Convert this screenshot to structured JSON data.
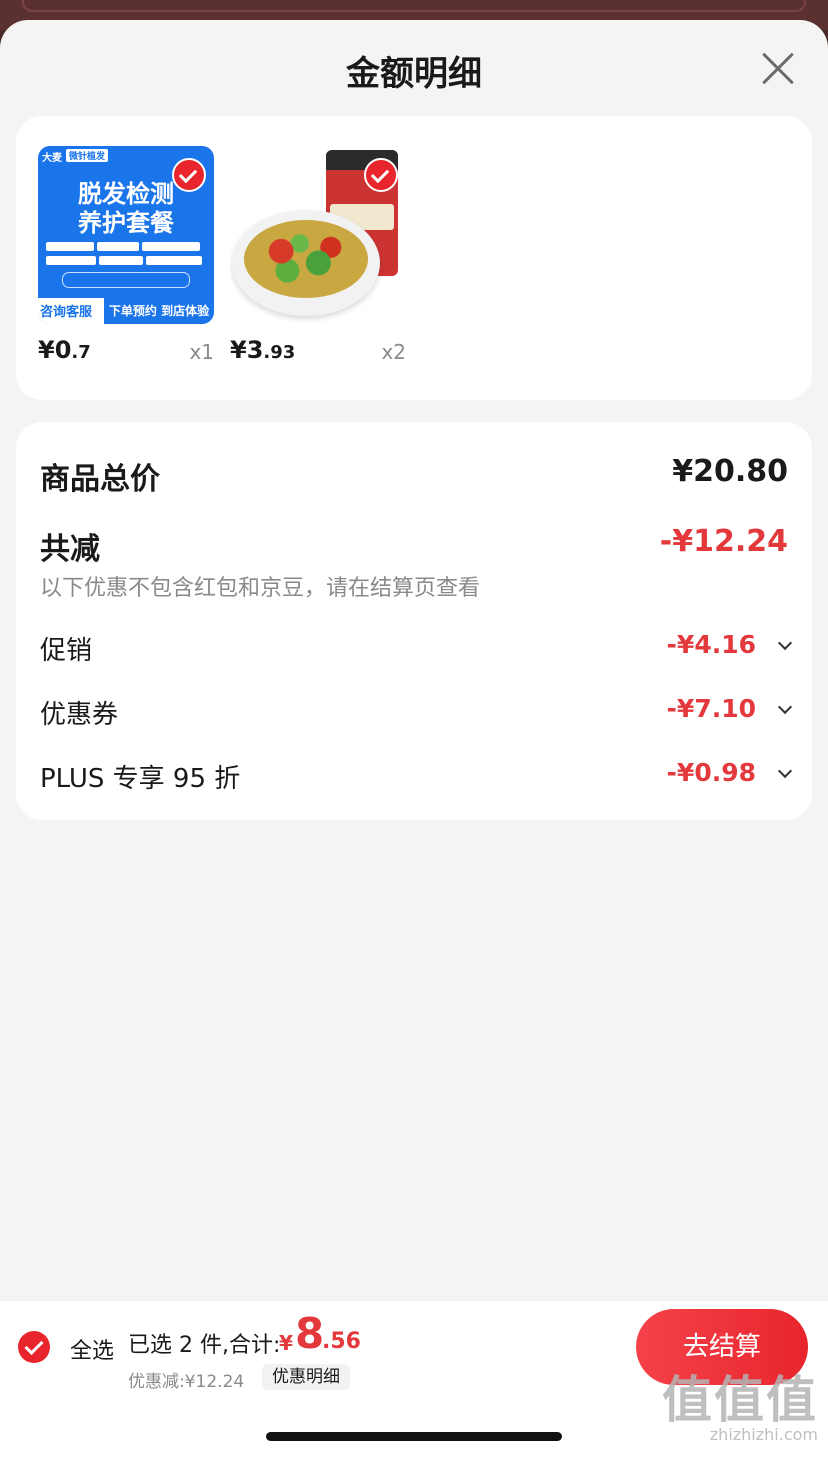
{
  "sheet": {
    "title": "金额明细"
  },
  "products": [
    {
      "thumb_title_line1": "脱发检测",
      "thumb_title_line2": "养护套餐",
      "thumb_brand": "大麦",
      "thumb_brand_tag": "微针植发",
      "thumb_left_tag": "咨询客服",
      "thumb_right_tag": "下单预约  到店体验",
      "price_int": "¥0",
      "price_dec": ".7",
      "qty": "x1",
      "checked": true
    },
    {
      "price_int": "¥3",
      "price_dec": ".93",
      "qty": "x2",
      "checked": true
    }
  ],
  "summary": {
    "total_label": "商品总价",
    "total_value": "¥20.80",
    "reduce_label": "共减",
    "reduce_value": "-¥12.24",
    "note": "以下优惠不包含红包和京豆，请在结算页查看",
    "items": [
      {
        "label": "促销",
        "value": "-¥4.16"
      },
      {
        "label": "优惠券",
        "value": "-¥7.10"
      },
      {
        "label": "PLUS 专享 95 折",
        "value": "-¥0.98"
      }
    ]
  },
  "footer": {
    "select_all": "全选",
    "selected_text": "已选 2 件,合计:",
    "sum_symbol": "¥",
    "sum_int": "8",
    "sum_dec": ".56",
    "discount_text": "优惠减:¥12.24",
    "detail_button": "优惠明细",
    "checkout_button": "去结算"
  },
  "watermark": {
    "line1": "值值值",
    "line2": "zhizhizhi.com"
  },
  "colors": {
    "accent_red": "#e4393c",
    "check_red": "#e8252c",
    "sheet_bg": "#f4f4f4"
  }
}
